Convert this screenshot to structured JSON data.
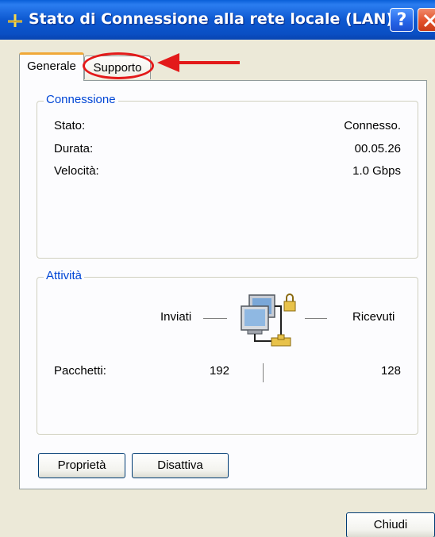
{
  "window": {
    "title": "Stato di Connessione alla rete locale (LAN)",
    "help_label": "?"
  },
  "tabs": [
    {
      "label": "Generale",
      "active": true
    },
    {
      "label": "Supporto",
      "active": false
    }
  ],
  "connection": {
    "group_label": "Connessione",
    "rows": [
      {
        "label": "Stato:",
        "value": "Connesso."
      },
      {
        "label": "Durata:",
        "value": "00.05.26"
      },
      {
        "label": "Velocità:",
        "value": "1.0 Gbps"
      }
    ]
  },
  "activity": {
    "group_label": "Attività",
    "sent_label": "Inviati",
    "received_label": "Ricevuti",
    "packets_label": "Pacchetti:",
    "packets_sent": "192",
    "packets_received": "128"
  },
  "buttons": {
    "properties": "Proprietà",
    "disable": "Disattiva",
    "close": "Chiudi"
  },
  "annotation": {
    "color": "#e31a1a"
  }
}
